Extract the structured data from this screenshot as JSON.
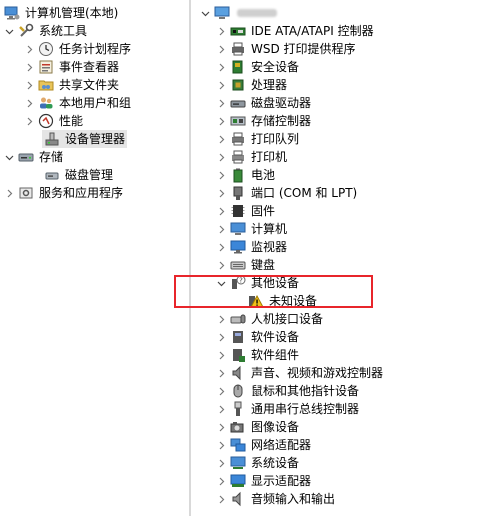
{
  "colors": {
    "selection": "#e5e5e5",
    "highlight_box": "#e8252b",
    "divider": "#d9d9d9"
  },
  "left_tree": {
    "root": "计算机管理(本地)",
    "system_tools": "系统工具",
    "task_scheduler": "任务计划程序",
    "event_viewer": "事件查看器",
    "shared_folders": "共享文件夹",
    "local_users_groups": "本地用户和组",
    "performance": "性能",
    "device_manager": "设备管理器",
    "storage": "存储",
    "disk_management": "磁盘管理",
    "services_apps": "服务和应用程序"
  },
  "right_tree": {
    "computer_name_blurred": "",
    "categories": [
      {
        "label": "IDE ATA/ATAPI 控制器",
        "icon": "ide-controller-icon"
      },
      {
        "label": "WSD 打印提供程序",
        "icon": "printer-provider-icon"
      },
      {
        "label": "安全设备",
        "icon": "security-device-icon"
      },
      {
        "label": "处理器",
        "icon": "processor-icon"
      },
      {
        "label": "磁盘驱动器",
        "icon": "disk-drive-icon"
      },
      {
        "label": "存储控制器",
        "icon": "storage-controller-icon"
      },
      {
        "label": "打印队列",
        "icon": "print-queue-icon"
      },
      {
        "label": "打印机",
        "icon": "printer-icon"
      },
      {
        "label": "电池",
        "icon": "battery-icon"
      },
      {
        "label": "端口 (COM 和 LPT)",
        "icon": "port-icon"
      },
      {
        "label": "固件",
        "icon": "firmware-icon"
      },
      {
        "label": "计算机",
        "icon": "computer-icon"
      },
      {
        "label": "监视器",
        "icon": "monitor-icon"
      },
      {
        "label": "键盘",
        "icon": "keyboard-icon"
      },
      {
        "label": "其他设备",
        "icon": "other-devices-icon",
        "expanded": true
      },
      {
        "label": "未知设备",
        "icon": "unknown-device-warning-icon",
        "child": true
      },
      {
        "label": "人机接口设备",
        "icon": "hid-icon"
      },
      {
        "label": "软件设备",
        "icon": "software-device-icon"
      },
      {
        "label": "软件组件",
        "icon": "software-component-icon"
      },
      {
        "label": "声音、视频和游戏控制器",
        "icon": "sound-icon"
      },
      {
        "label": "鼠标和其他指针设备",
        "icon": "mouse-icon"
      },
      {
        "label": "通用串行总线控制器",
        "icon": "usb-icon"
      },
      {
        "label": "图像设备",
        "icon": "camera-icon"
      },
      {
        "label": "网络适配器",
        "icon": "network-adapter-icon"
      },
      {
        "label": "系统设备",
        "icon": "system-device-icon"
      },
      {
        "label": "显示适配器",
        "icon": "display-adapter-icon"
      },
      {
        "label": "音频输入和输出",
        "icon": "audio-io-icon"
      }
    ]
  }
}
